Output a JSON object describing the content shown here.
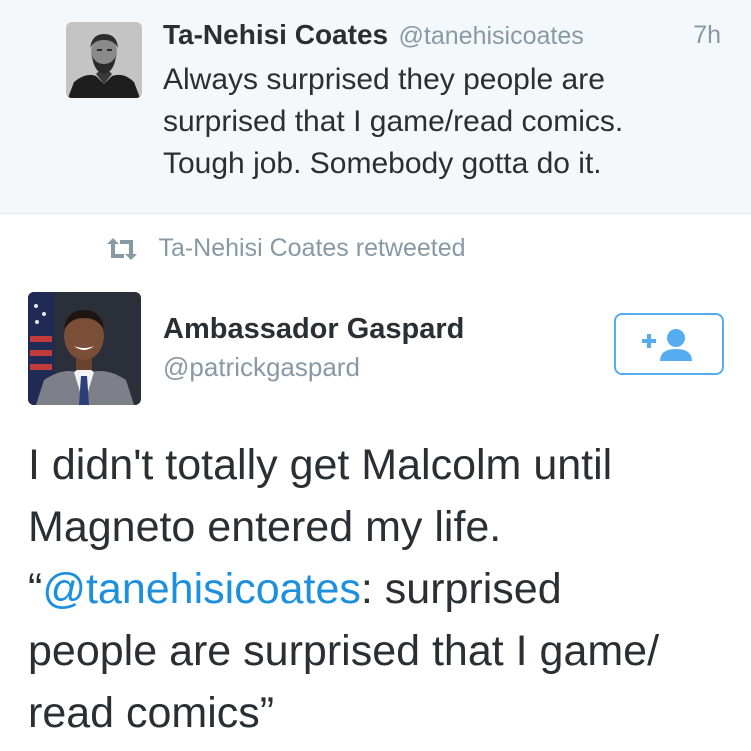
{
  "top_tweet": {
    "author_name": "Ta-Nehisi Coates",
    "author_handle": "@tanehisicoates",
    "time": "7h",
    "text_lines": [
      "Always surprised they people are",
      "surprised that I game/read comics.",
      "Tough job. Somebody gotta do it."
    ]
  },
  "retweet": {
    "icon": "retweet-icon",
    "label": "Ta-Nehisi Coates retweeted"
  },
  "main_tweet": {
    "author_name": "Ambassador Gaspard",
    "author_handle": "@patrickgaspard",
    "follow_icon": "add-user-icon",
    "text_lines": [
      "I didn't totally get Malcolm until",
      "Magneto entered my life."
    ],
    "quote_open": "“",
    "mention": "@tanehisicoates",
    "quote_after_mention": ": surprised",
    "quote_lines": [
      "people are surprised that I game/",
      "read comics”"
    ]
  },
  "colors": {
    "link": "#1d8fdf",
    "follow_border": "#55acee",
    "muted": "#8899a6",
    "text": "#292f33",
    "top_background": "#f5f8fa"
  }
}
